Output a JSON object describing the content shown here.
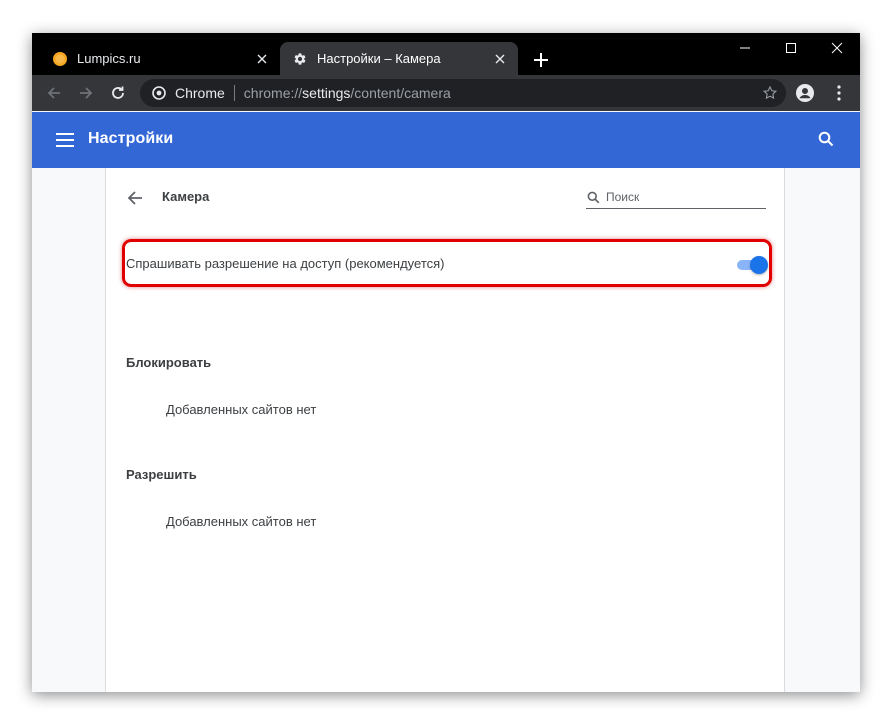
{
  "colors": {
    "tab_strip": "#000000",
    "toolbar": "#35363a",
    "header": "#3367d6",
    "toggle_active": "#1a73e8",
    "highlight": "#e00000",
    "tab_favicon": "#f5a623"
  },
  "tabs": [
    {
      "label": "Lumpics.ru",
      "icon": "orange-circle-icon",
      "active": false
    },
    {
      "label": "Настройки – Камера",
      "icon": "gear-icon",
      "active": true
    }
  ],
  "omnibox": {
    "site_chip": "Chrome",
    "url_prefix": "chrome://",
    "url_host": "settings",
    "url_path": "/content/camera"
  },
  "header": {
    "title": "Настройки"
  },
  "page": {
    "title": "Камера",
    "search_placeholder": "Поиск",
    "ask_permission_label": "Спрашивать разрешение на доступ (рекомендуется)",
    "ask_permission_enabled": true,
    "block_title": "Блокировать",
    "block_empty": "Добавленных сайтов нет",
    "allow_title": "Разрешить",
    "allow_empty": "Добавленных сайтов нет"
  }
}
